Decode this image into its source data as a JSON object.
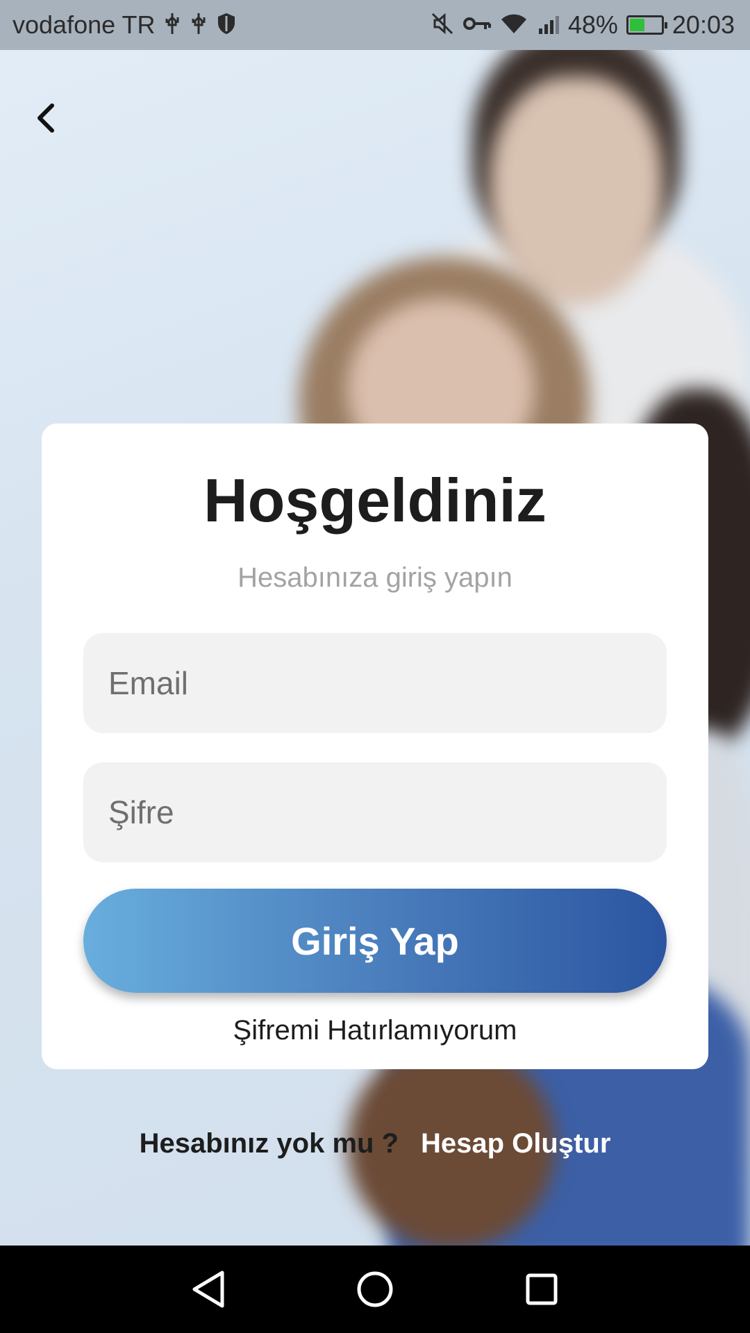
{
  "status_bar": {
    "carrier": "vodafone TR",
    "left_icons": [
      "usb-icon",
      "usb-icon",
      "shield-icon"
    ],
    "right_icons": [
      "mute-icon",
      "vpn-key-icon",
      "wifi-icon",
      "signal-3g-icon"
    ],
    "battery_percent": "48%",
    "battery_level": 0.48,
    "time": "20:03"
  },
  "header": {
    "back_icon": "chevron-left-icon"
  },
  "login": {
    "title": "Hoşgeldiniz",
    "subtitle": "Hesabınıza giriş yapın",
    "email_placeholder": "Email",
    "password_placeholder": "Şifre",
    "submit_label": "Giriş Yap",
    "forgot_label": "Şifremi Hatırlamıyorum"
  },
  "signup": {
    "question": "Hesabınız yok mu ?",
    "link_label": "Hesap Oluştur"
  },
  "nav_bar": {
    "buttons": [
      "back-triangle-icon",
      "home-circle-icon",
      "recents-square-icon"
    ]
  },
  "colors": {
    "button_gradient_start": "#68aedd",
    "button_gradient_end": "#2b55a1",
    "card_bg": "#ffffff",
    "input_bg": "#f2f2f2"
  }
}
